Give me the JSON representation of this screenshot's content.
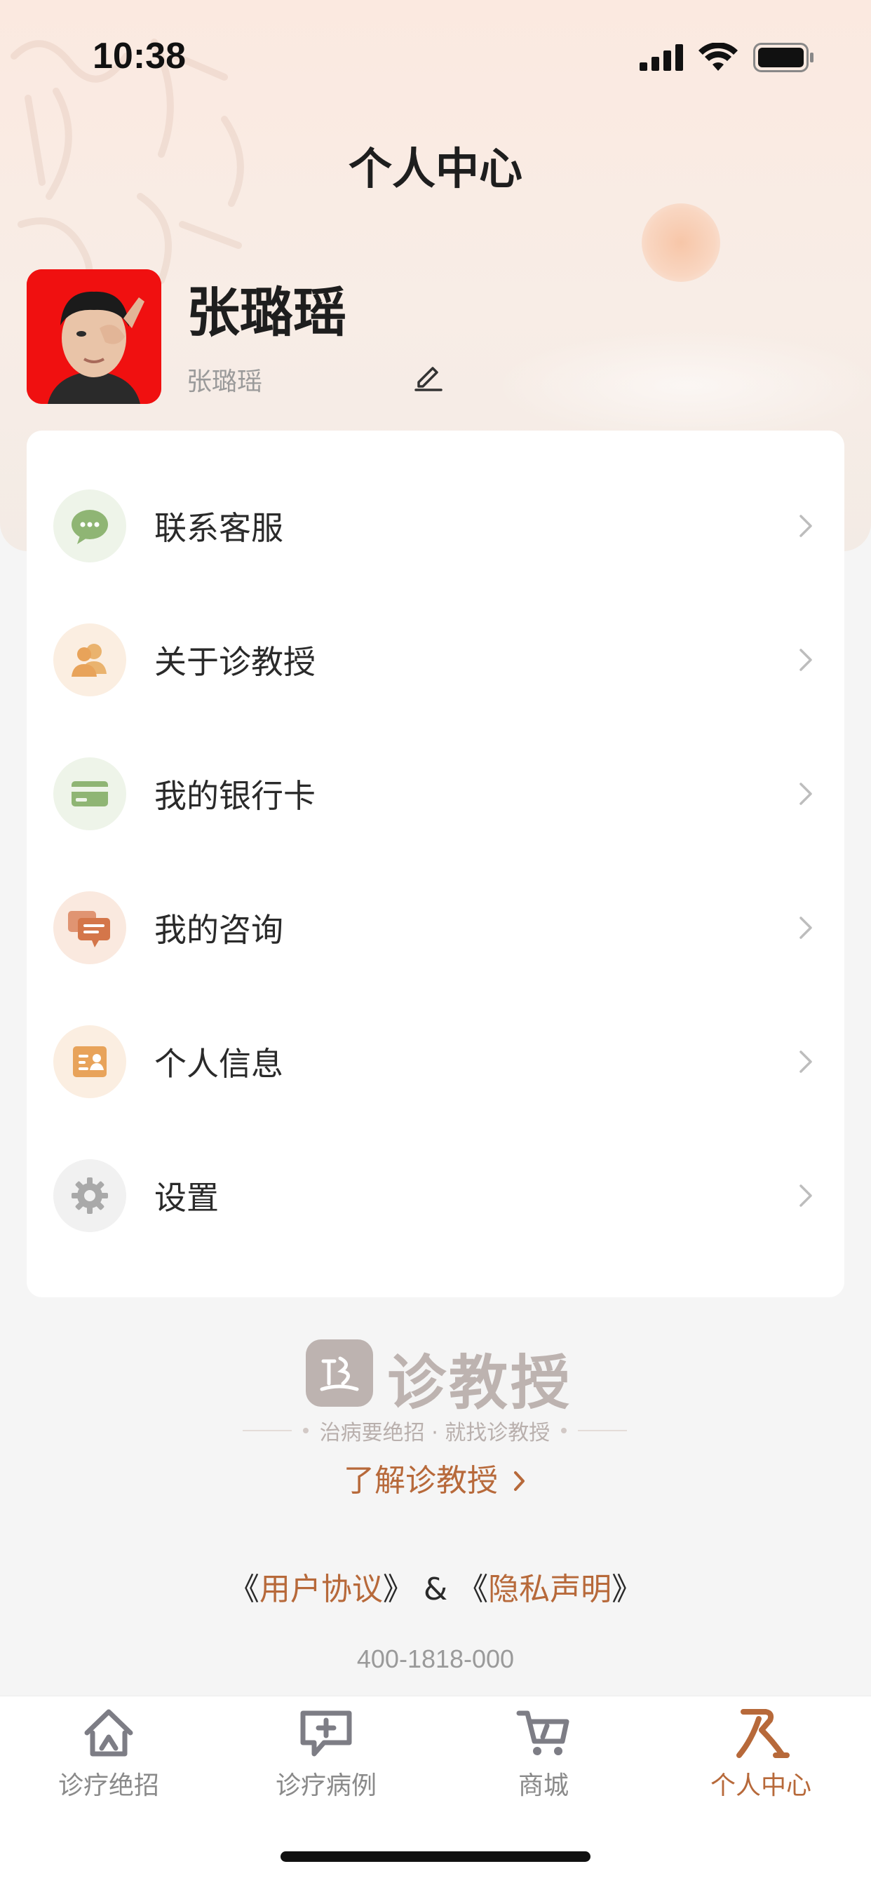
{
  "status_bar": {
    "time": "10:38"
  },
  "header": {
    "title": "个人中心"
  },
  "profile": {
    "name": "张璐瑶",
    "subtitle": "张璐瑶"
  },
  "menu": {
    "items": [
      {
        "label": "联系客服",
        "icon": "chat-bubble-icon",
        "color": "#8fb574"
      },
      {
        "label": "关于诊教授",
        "icon": "people-icon",
        "color": "#e8a35a"
      },
      {
        "label": "我的银行卡",
        "icon": "bank-card-icon",
        "color": "#8fb574"
      },
      {
        "label": "我的咨询",
        "icon": "consultation-icon",
        "color": "#d4764a"
      },
      {
        "label": "个人信息",
        "icon": "id-card-icon",
        "color": "#e8a35a"
      },
      {
        "label": "设置",
        "icon": "gear-icon",
        "color": "#a9a9a9"
      }
    ]
  },
  "brand": {
    "name": "诊教授",
    "slogan": "治病要绝招 · 就找诊教授",
    "learn_more": "了解诊教授"
  },
  "agreements": {
    "open1": "《",
    "user_agreement": "用户协议",
    "close1": "》",
    "amp": " & ",
    "open2": "《",
    "privacy": "隐私声明",
    "close2": "》"
  },
  "contact_phone": "400-1818-000",
  "tabs": [
    {
      "label": "诊疗绝招",
      "icon": "home-icon",
      "active": false
    },
    {
      "label": "诊疗病例",
      "icon": "medical-case-icon",
      "active": false
    },
    {
      "label": "商城",
      "icon": "cart-icon",
      "active": false
    },
    {
      "label": "个人中心",
      "icon": "person-icon",
      "active": true
    }
  ],
  "colors": {
    "accent": "#b7693a",
    "background": "#f5f5f5",
    "header": "#fbe9e0"
  }
}
